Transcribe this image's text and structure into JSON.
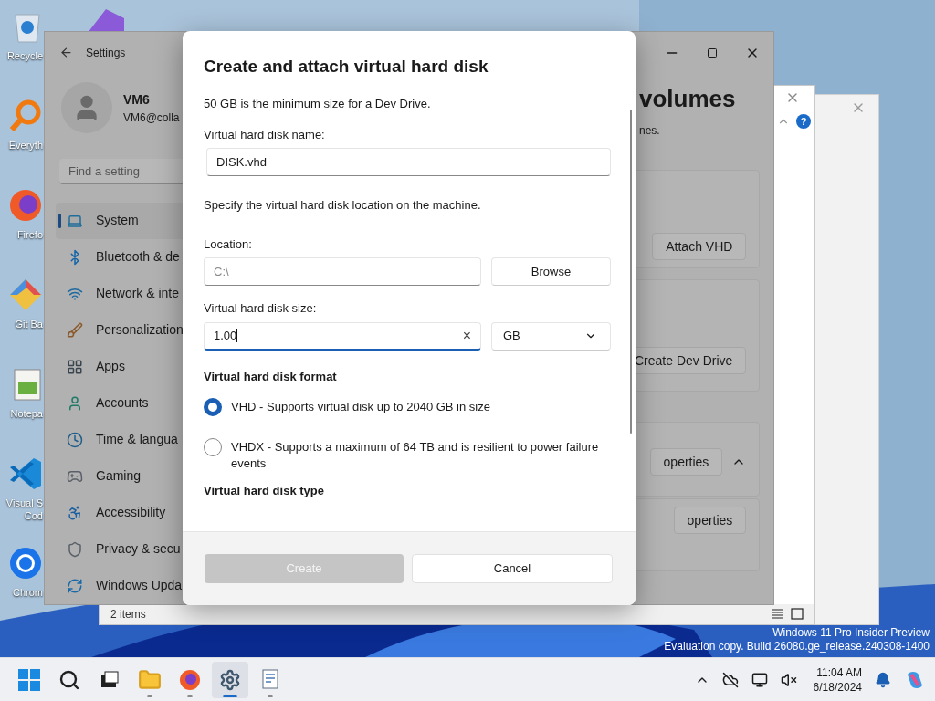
{
  "desktop_icons": [
    {
      "lines": [
        "Recycle"
      ],
      "kind": "recycle"
    },
    {
      "lines": [
        "Everyth"
      ],
      "kind": "search"
    },
    {
      "lines": [
        "Firefo"
      ],
      "kind": "browser"
    },
    {
      "lines": [
        "Git Ba"
      ],
      "kind": "git"
    },
    {
      "lines": [
        "Notepa"
      ],
      "kind": "notepad"
    },
    {
      "lines": [
        "Visual S",
        "Cod"
      ],
      "kind": "code"
    },
    {
      "lines": [
        "Chrom"
      ],
      "kind": "chrome"
    }
  ],
  "settings_window": {
    "title": "Settings",
    "user": {
      "name": "VM6",
      "email": "VM6@colla"
    },
    "search": {
      "placeholder": "Find a setting"
    },
    "nav": [
      {
        "label": "System",
        "kind": "system",
        "selected": true
      },
      {
        "label": "Bluetooth & de",
        "kind": "bluetooth",
        "selected": false
      },
      {
        "label": "Network & inte",
        "kind": "network",
        "selected": false
      },
      {
        "label": "Personalization",
        "kind": "brush",
        "selected": false
      },
      {
        "label": "Apps",
        "kind": "apps",
        "selected": false
      },
      {
        "label": "Accounts",
        "kind": "person",
        "selected": false
      },
      {
        "label": "Time & langua",
        "kind": "clock",
        "selected": false
      },
      {
        "label": "Gaming",
        "kind": "gamepad",
        "selected": false
      },
      {
        "label": "Accessibility",
        "kind": "accessibility",
        "selected": false
      },
      {
        "label": "Privacy & secu",
        "kind": "shield",
        "selected": false
      },
      {
        "label": "Windows Upda",
        "kind": "update",
        "selected": false
      }
    ],
    "heading": "volumes",
    "subtitle": "nes.",
    "cards": [
      {
        "button": "Attach VHD",
        "expanded": false
      },
      {
        "button": "Create Dev Drive",
        "expanded": false
      },
      {
        "button": "operties",
        "expanded": true
      },
      {
        "button": "operties",
        "expanded": false
      }
    ]
  },
  "explorer_window": {
    "status": "2 items",
    "help": "?"
  },
  "dialog": {
    "title": "Create and attach virtual hard disk",
    "note": "50 GB is the minimum size for a Dev Drive.",
    "name_label": "Virtual hard disk name:",
    "name_value": "DISK.vhd",
    "location_note": "Specify the virtual hard disk location on the machine.",
    "location_label": "Location:",
    "location_placeholder": "C:\\",
    "browse": "Browse",
    "size_label": "Virtual hard disk size:",
    "size_value": "1.00",
    "size_clear": "×",
    "unit": "GB",
    "format_label": "Virtual hard disk format",
    "formats": [
      {
        "label": "VHD - Supports virtual disk up to 2040 GB in size",
        "selected": true
      },
      {
        "label": "VHDX - Supports a maximum of 64 TB and is resilient to power failure events",
        "selected": false
      }
    ],
    "type_label": "Virtual hard disk type",
    "create": {
      "label": "Create",
      "disabled": true
    },
    "cancel": "Cancel"
  },
  "watermark": [
    "Windows 11 Pro Insider Preview",
    "Evaluation copy. Build 26080.ge_release.240308-1400"
  ],
  "taskbar": {
    "apps": [
      {
        "kind": "start",
        "running": false,
        "selected": false
      },
      {
        "kind": "search",
        "running": false,
        "selected": false
      },
      {
        "kind": "taskview",
        "running": false,
        "selected": false
      },
      {
        "kind": "folder",
        "running": true,
        "selected": false
      },
      {
        "kind": "firefox",
        "running": true,
        "selected": false
      },
      {
        "kind": "settings",
        "running": true,
        "selected": true
      },
      {
        "kind": "document",
        "running": true,
        "selected": false
      }
    ],
    "time": "11:04 AM",
    "date": "6/18/2024"
  }
}
